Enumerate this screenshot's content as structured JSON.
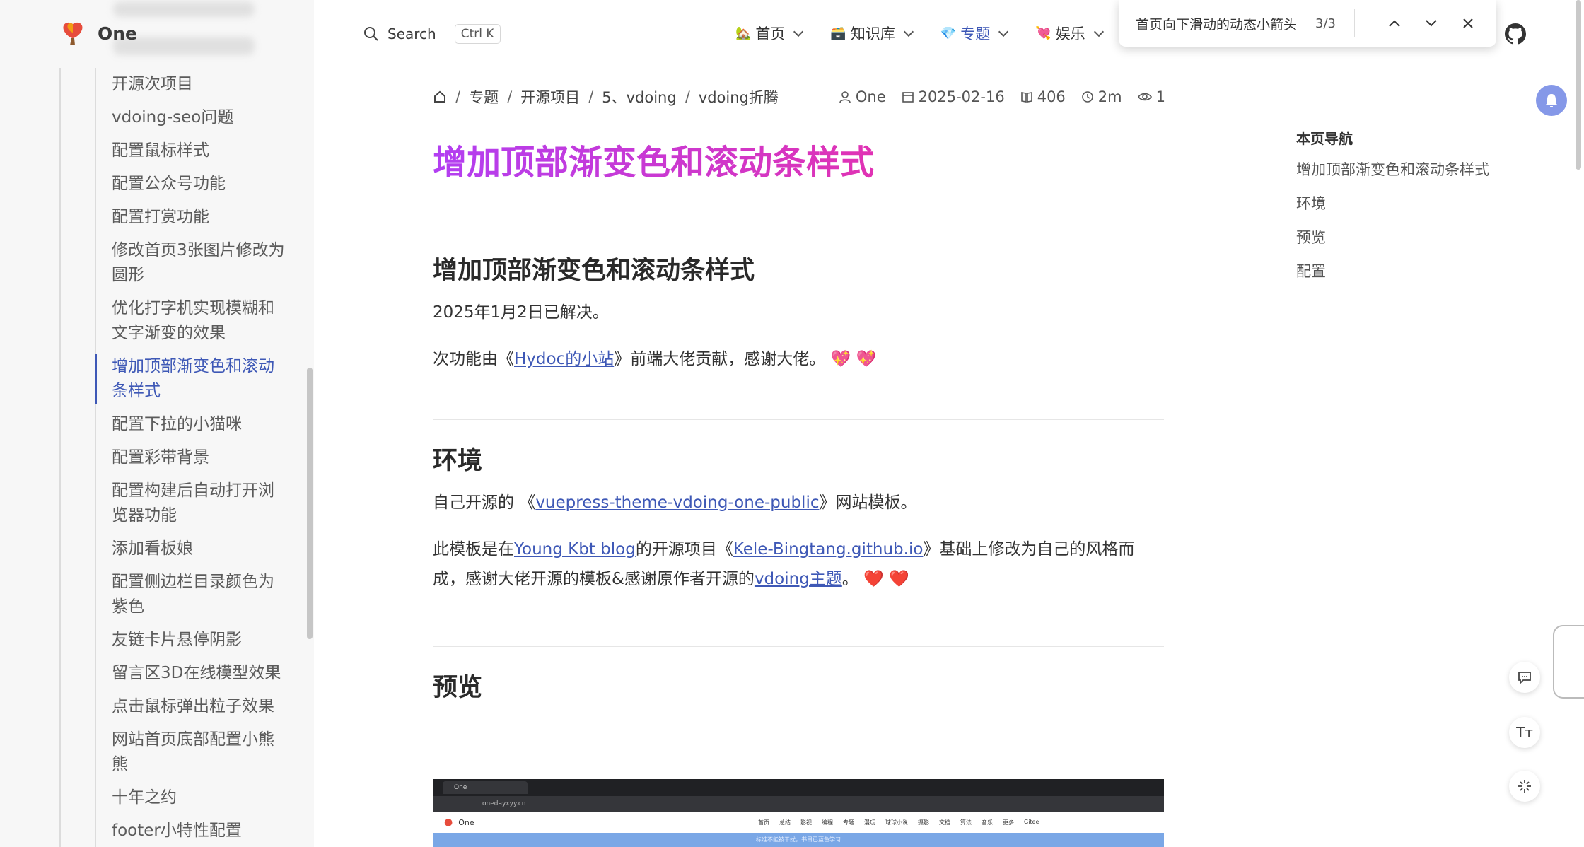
{
  "brand": {
    "name": "One"
  },
  "sidebar": {
    "items": [
      {
        "label": "开源次项目",
        "active": false
      },
      {
        "label": "vdoing-seo问题",
        "active": false
      },
      {
        "label": "配置鼠标样式",
        "active": false
      },
      {
        "label": "配置公众号功能",
        "active": false
      },
      {
        "label": "配置打赏功能",
        "active": false
      },
      {
        "label": "修改首页3张图片修改为圆形",
        "active": false
      },
      {
        "label": "优化打字机实现模糊和文字渐变的效果",
        "active": false
      },
      {
        "label": "增加顶部渐变色和滚动条样式",
        "active": true
      },
      {
        "label": "配置下拉的小猫咪",
        "active": false
      },
      {
        "label": "配置彩带背景",
        "active": false
      },
      {
        "label": "配置构建后自动打开浏览器功能",
        "active": false
      },
      {
        "label": "添加看板娘",
        "active": false
      },
      {
        "label": "配置侧边栏目录颜色为紫色",
        "active": false
      },
      {
        "label": "友链卡片悬停阴影",
        "active": false
      },
      {
        "label": "留言区3D在线模型效果",
        "active": false
      },
      {
        "label": "点击鼠标弹出粒子效果",
        "active": false
      },
      {
        "label": "网站首页底部配置小熊熊",
        "active": false
      },
      {
        "label": "十年之约",
        "active": false
      },
      {
        "label": "footer小特性配置",
        "active": false
      }
    ]
  },
  "header": {
    "search_label": "Search",
    "search_kbd": "Ctrl K",
    "nav": [
      {
        "emoji": "🏡",
        "label": "首页",
        "current": false
      },
      {
        "emoji": "🗃️",
        "label": "知识库",
        "current": false
      },
      {
        "emoji": "💎",
        "label": "专题",
        "current": true
      },
      {
        "emoji": "💘",
        "label": "娱乐",
        "current": false
      }
    ]
  },
  "findbar": {
    "query": "首页向下滑动的动态小箭头",
    "count": "3/3"
  },
  "article": {
    "breadcrumb": [
      "专题",
      "开源项目",
      "5、vdoing",
      "vdoing折腾"
    ],
    "meta": {
      "author": "One",
      "date": "2025-02-16",
      "words": "406",
      "read_time": "2m",
      "views": "1"
    },
    "title": "增加顶部渐变色和滚动条样式",
    "section1": {
      "heading": "增加顶部渐变色和滚动条样式",
      "p1": "2025年1月2日已解决。",
      "p2_pre": "次功能由《",
      "p2_link": "Hydoc的小站",
      "p2_post": "》前端大佬贡献，感谢大佬。",
      "hearts": "💖 💖"
    },
    "section2": {
      "heading": "环境",
      "p1_pre": "自己开源的 《",
      "p1_link": "vuepress-theme-vdoing-one-public",
      "p1_post": "》网站模板。",
      "p2_a": "此模板是在",
      "p2_link1": "Young Kbt blog",
      "p2_b": "的开源项目《",
      "p2_link2": "Kele-Bingtang.github.io",
      "p2_c": "》基础上修改为自己的风格而成，感谢大佬开源的模板&感谢原作者开源的",
      "p2_link3": "vdoing主题",
      "p2_d": "。",
      "hearts": "❤️ ❤️"
    },
    "section3": {
      "heading": "预览"
    }
  },
  "toc": {
    "title": "本页导航",
    "items": [
      "增加顶部渐变色和滚动条样式",
      "环境",
      "预览",
      "配置"
    ]
  },
  "preview": {
    "tab": "One",
    "url": "onedayxyy.cn",
    "brand": "One",
    "nav": [
      "首页",
      "总结",
      "影视",
      "编程",
      "专题",
      "漫玩",
      "球球小说",
      "摄影",
      "文档",
      "算法",
      "音乐",
      "更多",
      "Gitee"
    ],
    "banner": "标准不能被干扰，书目已蓝色学习"
  },
  "float_buttons": {
    "comment": "comment-icon",
    "font": "Tт",
    "theme": "theme-icon"
  }
}
